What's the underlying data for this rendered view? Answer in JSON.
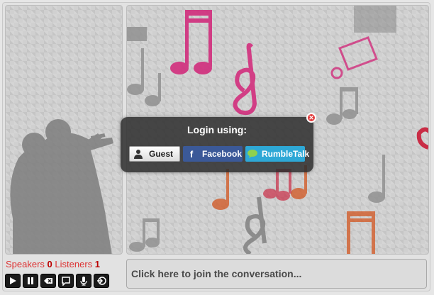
{
  "status": {
    "speakers_label": "Speakers",
    "speakers_count": "0",
    "listeners_label": "Listeners",
    "listeners_count": "1"
  },
  "controls": [
    {
      "icon": "play-icon"
    },
    {
      "icon": "pause-icon"
    },
    {
      "icon": "backspace-icon"
    },
    {
      "icon": "chat-bubble-icon"
    },
    {
      "icon": "microphone-icon"
    },
    {
      "icon": "exit-icon"
    }
  ],
  "message": {
    "placeholder": "Click here to join the conversation..."
  },
  "login": {
    "title": "Login using:",
    "guest_label": "Guest",
    "facebook_label": "Facebook",
    "rumbletalk_label": "RumbleTalk"
  },
  "colors": {
    "facebook": "#3b5998",
    "rumbletalk": "#2ea8d6",
    "status_red": "#d33333",
    "close_red": "#e23b3b"
  }
}
